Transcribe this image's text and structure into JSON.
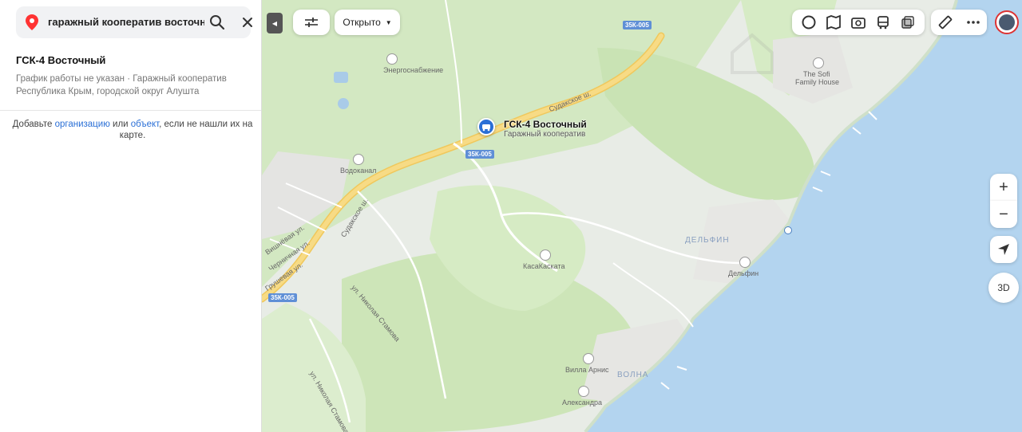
{
  "search": {
    "query": "гаражный кооператив восточный",
    "icons": [
      "map-pin-icon",
      "search-icon",
      "close-icon"
    ]
  },
  "result": {
    "title": "ГСК-4 Восточный",
    "meta_line1": "График работы не указан · Гаражный кооператив",
    "meta_line2": "Республика Крым, городской округ Алушта"
  },
  "add_note": {
    "prefix": "Добавьте ",
    "link_org": "организацию",
    "middle": " или ",
    "link_obj": "объект",
    "suffix": ", если не нашли их на карте."
  },
  "map": {
    "marker_title": "ГСК-4 Восточный",
    "marker_subtitle": "Гаражный кооператив",
    "labels": {
      "energo": "Энергоснабжение",
      "vodokanal": "Водоканал",
      "sudak1": "Судакское ш.",
      "sudak2": "Судакское ш.",
      "kasa": "КасаКаската",
      "delfin_district": "ДЕЛЬФИН",
      "delfin_poi": "Дельфин",
      "villa": "Вилла Арнис",
      "volna": "ВОЛНА",
      "aleksandra": "Александра",
      "sofi1": "The Sofi",
      "sofi2": "Family House",
      "nikola1": "ул. Николая Стамова",
      "nikola2": "ул. Николая Стамова",
      "vishnevaya": "Вишнёвая ул.",
      "chernichnaya": "Черничная ул.",
      "grushevaya": "Грушевая ул."
    },
    "road_shields": [
      "35К-005",
      "35К-005",
      "35К-005"
    ]
  },
  "controls": {
    "open_label": "Открыто",
    "zoom_in": "+",
    "zoom_out": "−",
    "btn_3d": "3D",
    "collapse": "◀"
  },
  "colors": {
    "accent": "#2a6fd6",
    "sea": "#b3d4ef",
    "green": "#d5ebc6",
    "road": "#f4d37a"
  }
}
